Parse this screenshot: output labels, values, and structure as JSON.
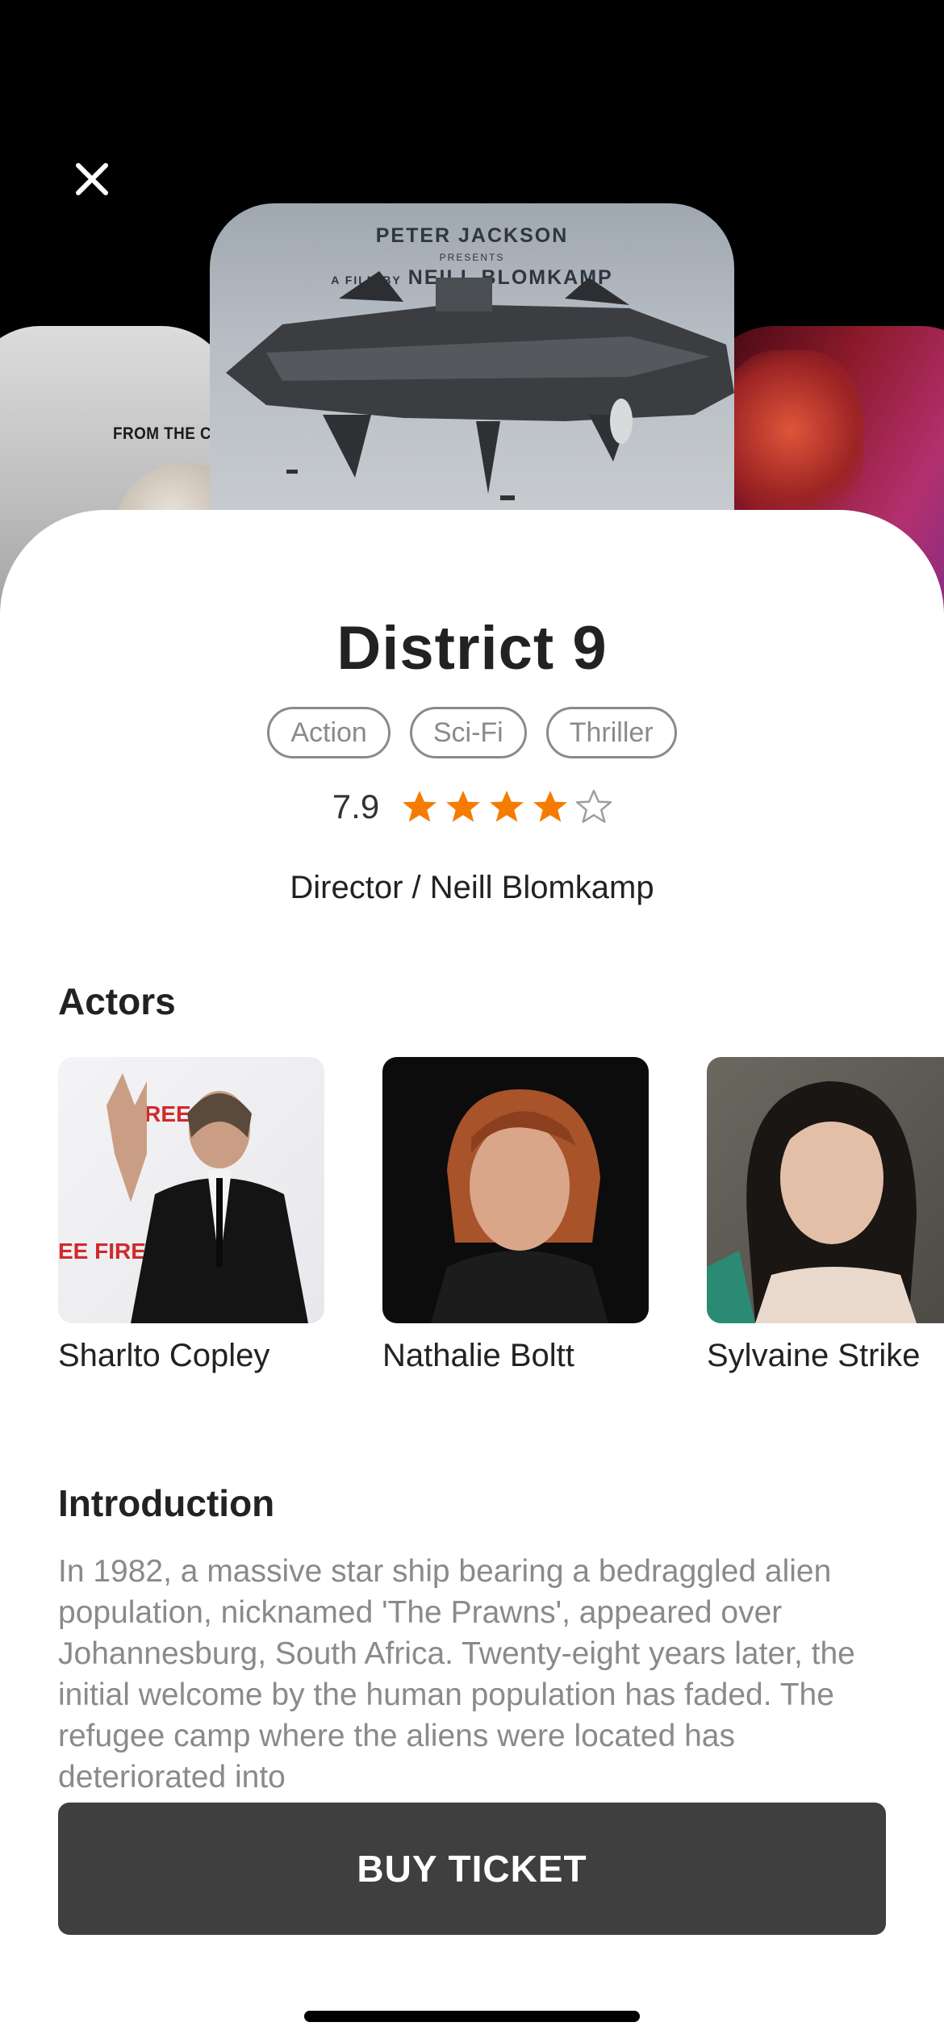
{
  "posters": {
    "left_tagline": "FROM THE CR",
    "center_credit_1": "PETER JACKSON",
    "center_credit_2": "PRESENTS",
    "center_credit_3_prefix": "A FILM BY",
    "center_credit_3": "NEILL BLOMKAMP"
  },
  "movie": {
    "title": "District 9",
    "genres": [
      "Action",
      "Sci-Fi",
      "Thriller"
    ],
    "rating": "7.9",
    "stars": {
      "filled": 4,
      "total": 5
    },
    "director": "Director / Neill Blomkamp"
  },
  "actors": {
    "heading": "Actors",
    "list": [
      {
        "name": "Sharlto Copley"
      },
      {
        "name": "Nathalie Boltt"
      },
      {
        "name": "Sylvaine Strike"
      }
    ]
  },
  "introduction": {
    "heading": "Introduction",
    "text": "In 1982, a massive star ship bearing a bedraggled alien population, nicknamed 'The Prawns', appeared over Johannesburg, South Africa. Twenty-eight years later, the initial welcome by the human population has faded. The refugee camp where the aliens were located has deteriorated into"
  },
  "buy_button": {
    "label": "BUY TICKET"
  },
  "colors": {
    "star": "#F57C00",
    "star_empty": "#9E9E9E",
    "button": "#3F3F3F"
  },
  "icons": {
    "close": "close-icon",
    "star": "star-icon"
  }
}
